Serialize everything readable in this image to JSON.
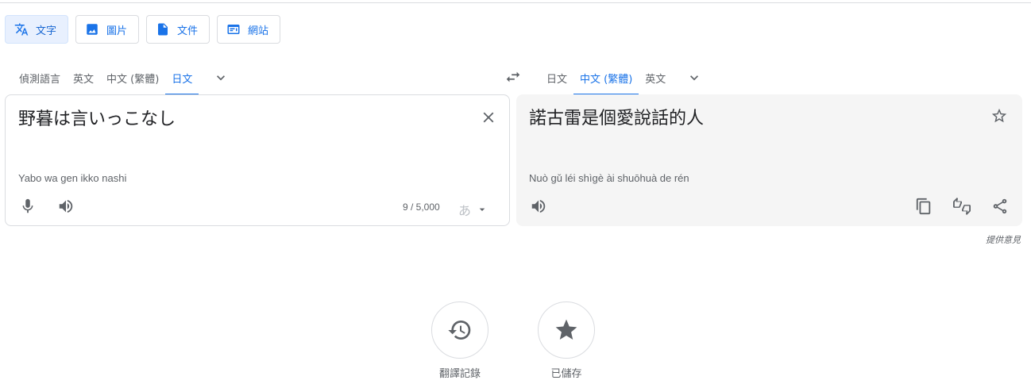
{
  "modes": [
    {
      "label": "文字",
      "icon": "translate-icon"
    },
    {
      "label": "圖片",
      "icon": "image-icon"
    },
    {
      "label": "文件",
      "icon": "document-icon"
    },
    {
      "label": "網站",
      "icon": "website-icon"
    }
  ],
  "source_langs": [
    "偵測語言",
    "英文",
    "中文 (繁體)",
    "日文"
  ],
  "target_langs": [
    "日文",
    "中文 (繁體)",
    "英文"
  ],
  "source": {
    "text": "野暮は言いっこなし",
    "romanization": "Yabo wa gen ikko nashi",
    "char_count": "9 / 5,000",
    "ime": "あ"
  },
  "target": {
    "text": "諾古雷是個愛說話的人",
    "romanization": "Nuò gǔ léi shìgè ài shuōhuà de rén"
  },
  "feedback": "提供意見",
  "bottom": {
    "history": "翻譯記錄",
    "saved": "已儲存"
  },
  "colors": {
    "accent": "#1a73e8",
    "panel_bg": "#f5f5f5"
  }
}
